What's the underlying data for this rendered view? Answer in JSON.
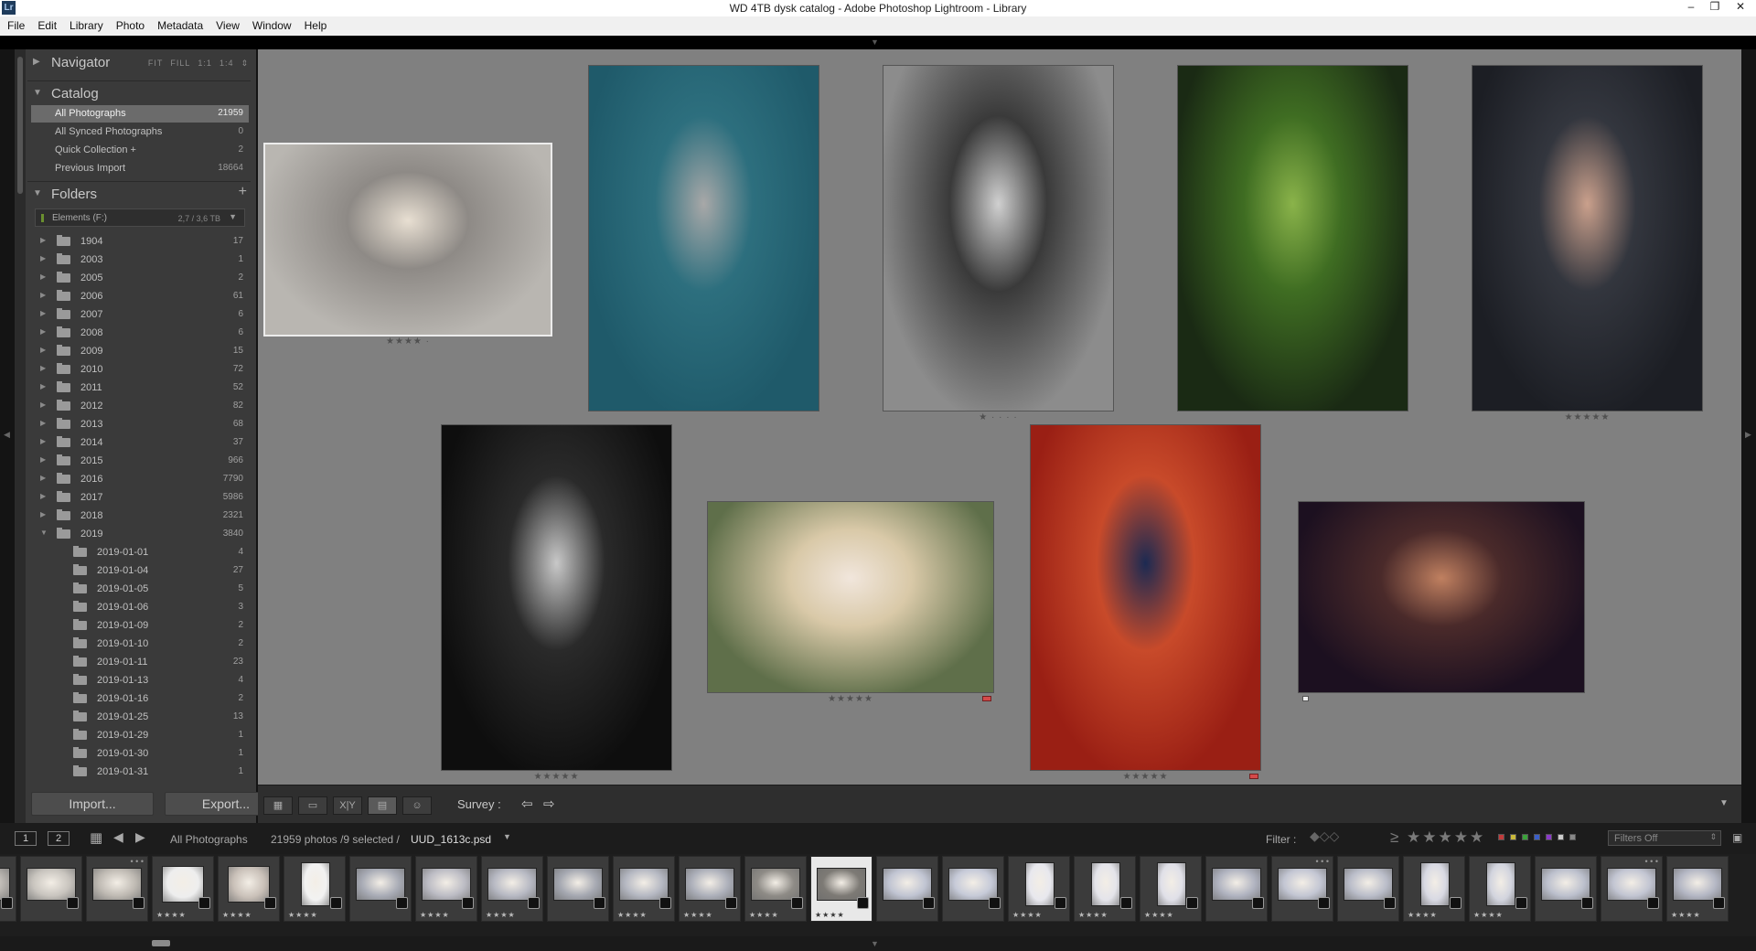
{
  "window": {
    "title": "WD 4TB dysk catalog - Adobe Photoshop Lightroom - Library",
    "app_badge": "Lr",
    "minimize": "–",
    "restore": "❐",
    "close": "✕"
  },
  "menu": [
    "File",
    "Edit",
    "Library",
    "Photo",
    "Metadata",
    "View",
    "Window",
    "Help"
  ],
  "navigator": {
    "label": "Navigator",
    "options": [
      "FIT",
      "FILL",
      "1:1",
      "1:4"
    ],
    "stepper": "⇕"
  },
  "catalog": {
    "label": "Catalog",
    "items": [
      {
        "name": "All Photographs",
        "count": "21959",
        "selected": true
      },
      {
        "name": "All Synced Photographs",
        "count": "0"
      },
      {
        "name": "Quick Collection  +",
        "count": "2"
      },
      {
        "name": "Previous Import",
        "count": "18664"
      }
    ]
  },
  "folders": {
    "label": "Folders",
    "add": "+",
    "volume": {
      "name": "Elements (F:)",
      "capacity": "2,7 / 3,6 TB",
      "dropdown": "▼"
    },
    "items": [
      {
        "name": "1904",
        "count": "17",
        "level": 0,
        "expanded": false
      },
      {
        "name": "2003",
        "count": "1",
        "level": 0,
        "expanded": false
      },
      {
        "name": "2005",
        "count": "2",
        "level": 0,
        "expanded": false
      },
      {
        "name": "2006",
        "count": "61",
        "level": 0,
        "expanded": false
      },
      {
        "name": "2007",
        "count": "6",
        "level": 0,
        "expanded": false
      },
      {
        "name": "2008",
        "count": "6",
        "level": 0,
        "expanded": false
      },
      {
        "name": "2009",
        "count": "15",
        "level": 0,
        "expanded": false
      },
      {
        "name": "2010",
        "count": "72",
        "level": 0,
        "expanded": false
      },
      {
        "name": "2011",
        "count": "52",
        "level": 0,
        "expanded": false
      },
      {
        "name": "2012",
        "count": "82",
        "level": 0,
        "expanded": false
      },
      {
        "name": "2013",
        "count": "68",
        "level": 0,
        "expanded": false
      },
      {
        "name": "2014",
        "count": "37",
        "level": 0,
        "expanded": false
      },
      {
        "name": "2015",
        "count": "966",
        "level": 0,
        "expanded": false
      },
      {
        "name": "2016",
        "count": "7790",
        "level": 0,
        "expanded": false
      },
      {
        "name": "2017",
        "count": "5986",
        "level": 0,
        "expanded": false
      },
      {
        "name": "2018",
        "count": "2321",
        "level": 0,
        "expanded": false
      },
      {
        "name": "2019",
        "count": "3840",
        "level": 0,
        "expanded": true
      },
      {
        "name": "2019-01-01",
        "count": "4",
        "level": 1
      },
      {
        "name": "2019-01-04",
        "count": "27",
        "level": 1
      },
      {
        "name": "2019-01-05",
        "count": "5",
        "level": 1
      },
      {
        "name": "2019-01-06",
        "count": "3",
        "level": 1
      },
      {
        "name": "2019-01-09",
        "count": "2",
        "level": 1
      },
      {
        "name": "2019-01-10",
        "count": "2",
        "level": 1
      },
      {
        "name": "2019-01-11",
        "count": "23",
        "level": 1
      },
      {
        "name": "2019-01-13",
        "count": "4",
        "level": 1
      },
      {
        "name": "2019-01-16",
        "count": "2",
        "level": 1
      },
      {
        "name": "2019-01-25",
        "count": "13",
        "level": 1
      },
      {
        "name": "2019-01-29",
        "count": "1",
        "level": 1
      },
      {
        "name": "2019-01-30",
        "count": "1",
        "level": 1
      },
      {
        "name": "2019-01-31",
        "count": "1",
        "level": 1
      }
    ]
  },
  "buttons": {
    "import": "Import...",
    "export": "Export..."
  },
  "survey": {
    "photos": [
      {
        "id": "parasol",
        "rating": "★★★★ ·",
        "selected": true,
        "colors": [
          "#b9b6b1",
          "#8e8a86",
          "#e8dfd2"
        ]
      },
      {
        "id": "cowboy-hat",
        "rating": "",
        "colors": [
          "#1f5a6a",
          "#2d6f7e",
          "#a8a8a8"
        ]
      },
      {
        "id": "rocking-horse",
        "rating": "★ · · · ·",
        "colors": [
          "#8c8c8c",
          "#3a3a3a",
          "#d0d0d0"
        ]
      },
      {
        "id": "green-hair",
        "rating": "",
        "colors": [
          "#1a2a14",
          "#3f6d22",
          "#8ab34a"
        ]
      },
      {
        "id": "violin",
        "rating": "★★★★★",
        "colors": [
          "#1c1e24",
          "#33363e",
          "#caa08c"
        ]
      },
      {
        "id": "hooded-bw",
        "rating": "★★★★★",
        "colors": [
          "#0e0e0e",
          "#2a2a2a",
          "#c8c8c8"
        ]
      },
      {
        "id": "blonde-cigarette",
        "rating": "★★★★★",
        "colors": [
          "#5f6f4a",
          "#d9c9a8",
          "#f1e6dc"
        ],
        "flag": "red"
      },
      {
        "id": "red-leaves",
        "rating": "★★★★★",
        "colors": [
          "#9a1f14",
          "#c84a2a",
          "#1c2a52"
        ],
        "flag": "red"
      },
      {
        "id": "veil-portrait",
        "rating": "",
        "colors": [
          "#1c1020",
          "#4a2a2a",
          "#c08060"
        ],
        "flag": "white"
      }
    ]
  },
  "toolbar": {
    "survey_label": "Survey :",
    "prev": "⇦",
    "next": "⇨",
    "xy_label": "X|Y",
    "menu": "▼"
  },
  "filmbar": {
    "page1": "1",
    "page2": "2",
    "source": "All Photographs",
    "status": "21959 photos /9 selected /",
    "filename": "UUD_1613c.psd",
    "filter_label": "Filter :",
    "filter_stars": "≥ ★★★★★",
    "filter_value": "Filters Off",
    "colors": [
      "#c23b3b",
      "#c9b83a",
      "#3aa23a",
      "#3a5ec9",
      "#8a3ac9",
      "#cccccc",
      "#888888"
    ]
  },
  "filmstrip": {
    "cells": [
      {
        "stars": "",
        "shade": "#b7b3ae"
      },
      {
        "stars": "",
        "shade": "#c8c4be"
      },
      {
        "stars": "",
        "shade": "#bfbab3",
        "dots": true
      },
      {
        "stars": "★★★★",
        "shade": "#eeeeee",
        "diamond": true
      },
      {
        "stars": "★★★★",
        "shade": "#c9c0b8",
        "diamond": true
      },
      {
        "stars": "★★★★",
        "shade": "#f2f2f2",
        "portrait": true
      },
      {
        "stars": "",
        "shade": "#a9acb6"
      },
      {
        "stars": "★★★★",
        "shade": "#bcbcc4"
      },
      {
        "stars": "★★★★",
        "shade": "#b7b9c3"
      },
      {
        "stars": "",
        "shade": "#a5a8b1"
      },
      {
        "stars": "★★★★",
        "shade": "#b5b8c2"
      },
      {
        "stars": "★★★★",
        "shade": "#adb0ba"
      },
      {
        "stars": "★★★★",
        "shade": "#8e8b86"
      },
      {
        "stars": "★★★★",
        "shade": "#7d7a75",
        "active": true
      },
      {
        "stars": "",
        "shade": "#c0c4d2"
      },
      {
        "stars": "",
        "shade": "#c6cad8"
      },
      {
        "stars": "★★★★",
        "shade": "#e8e8ee",
        "portrait": true
      },
      {
        "stars": "★★★★",
        "shade": "#e4e4ea",
        "portrait": true
      },
      {
        "stars": "★★★★",
        "shade": "#e0e0e8",
        "portrait": true
      },
      {
        "stars": "",
        "shade": "#b0b3c0"
      },
      {
        "stars": "",
        "shade": "#c3c6d3",
        "dots": true
      },
      {
        "stars": "",
        "shade": "#babdc9"
      },
      {
        "stars": "★★★★",
        "shade": "#d8d9e3",
        "portrait": true
      },
      {
        "stars": "★★★★",
        "shade": "#d2d4de",
        "portrait": true
      },
      {
        "stars": "",
        "shade": "#bcc0cd"
      },
      {
        "stars": "",
        "shade": "#c2c5d2",
        "dots": true
      },
      {
        "stars": "★★★★",
        "shade": "#b4b7c4"
      }
    ]
  }
}
